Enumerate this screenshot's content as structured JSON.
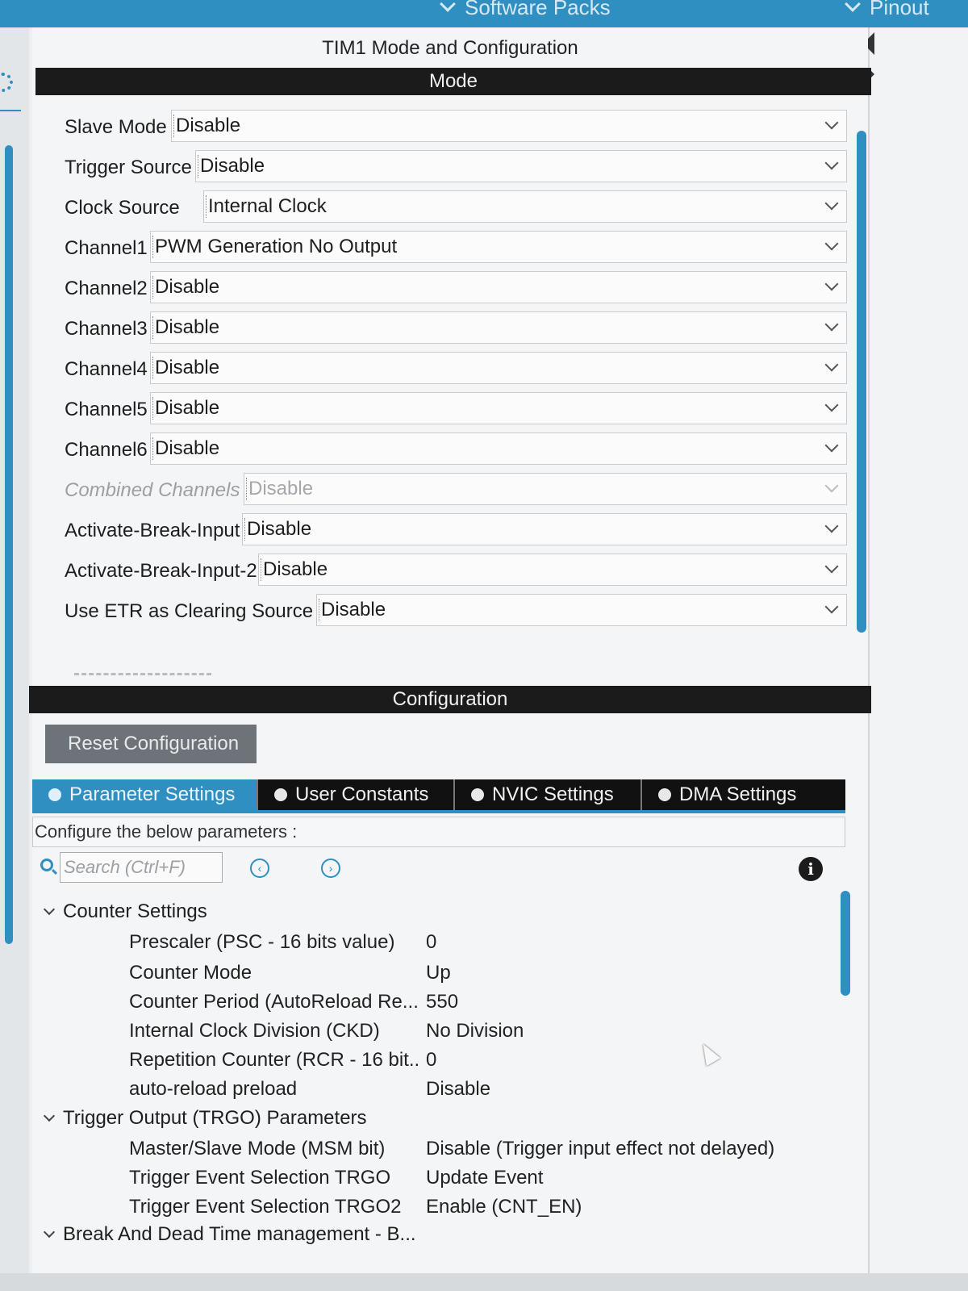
{
  "topbar": {
    "software_packs": "Software Packs",
    "pinout": "Pinout"
  },
  "panel": {
    "title": "TIM1 Mode and Configuration"
  },
  "mode": {
    "header": "Mode",
    "rows": [
      {
        "label": "Slave Mode",
        "value": "Disable"
      },
      {
        "label": "Trigger Source",
        "value": "Disable"
      },
      {
        "label": "Clock Source",
        "value": "Internal Clock"
      },
      {
        "label": "Channel1",
        "value": "PWM Generation No Output"
      },
      {
        "label": "Channel2",
        "value": "Disable"
      },
      {
        "label": "Channel3",
        "value": "Disable"
      },
      {
        "label": "Channel4",
        "value": "Disable"
      },
      {
        "label": "Channel5",
        "value": "Disable"
      },
      {
        "label": "Channel6",
        "value": "Disable"
      },
      {
        "label": "Combined Channels",
        "value": "Disable",
        "disabled": true
      },
      {
        "label": "Activate-Break-Input",
        "value": "Disable"
      },
      {
        "label": "Activate-Break-Input-2",
        "value": "Disable"
      },
      {
        "label": "Use ETR as Clearing Source",
        "value": "Disable"
      }
    ]
  },
  "configuration": {
    "header": "Configuration",
    "reset_label": "Reset Configuration",
    "tabs": [
      "Parameter Settings",
      "User Constants",
      "NVIC Settings",
      "DMA Settings"
    ],
    "description": "Configure the below parameters :",
    "search_placeholder": "Search (Ctrl+F)"
  },
  "parameters": {
    "counter_settings": {
      "title": "Counter Settings",
      "rows": [
        {
          "name": "Prescaler (PSC - 16 bits value)",
          "value": "0"
        },
        {
          "name": "Counter Mode",
          "value": "Up"
        },
        {
          "name": "Counter Period (AutoReload Re...",
          "value": "550"
        },
        {
          "name": "Internal Clock Division (CKD)",
          "value": "No Division"
        },
        {
          "name": "Repetition Counter (RCR - 16 bit...",
          "value": "0"
        },
        {
          "name": "auto-reload preload",
          "value": "Disable"
        }
      ]
    },
    "trgo": {
      "title": "Trigger Output (TRGO) Parameters",
      "rows": [
        {
          "name": "Master/Slave Mode (MSM bit)",
          "value": "Disable (Trigger input effect not delayed)"
        },
        {
          "name": "Trigger Event Selection TRGO",
          "value": "Update Event"
        },
        {
          "name": "Trigger Event Selection TRGO2",
          "value": "Enable (CNT_EN)"
        }
      ]
    },
    "break": {
      "title": "Break And Dead Time management - B..."
    }
  }
}
